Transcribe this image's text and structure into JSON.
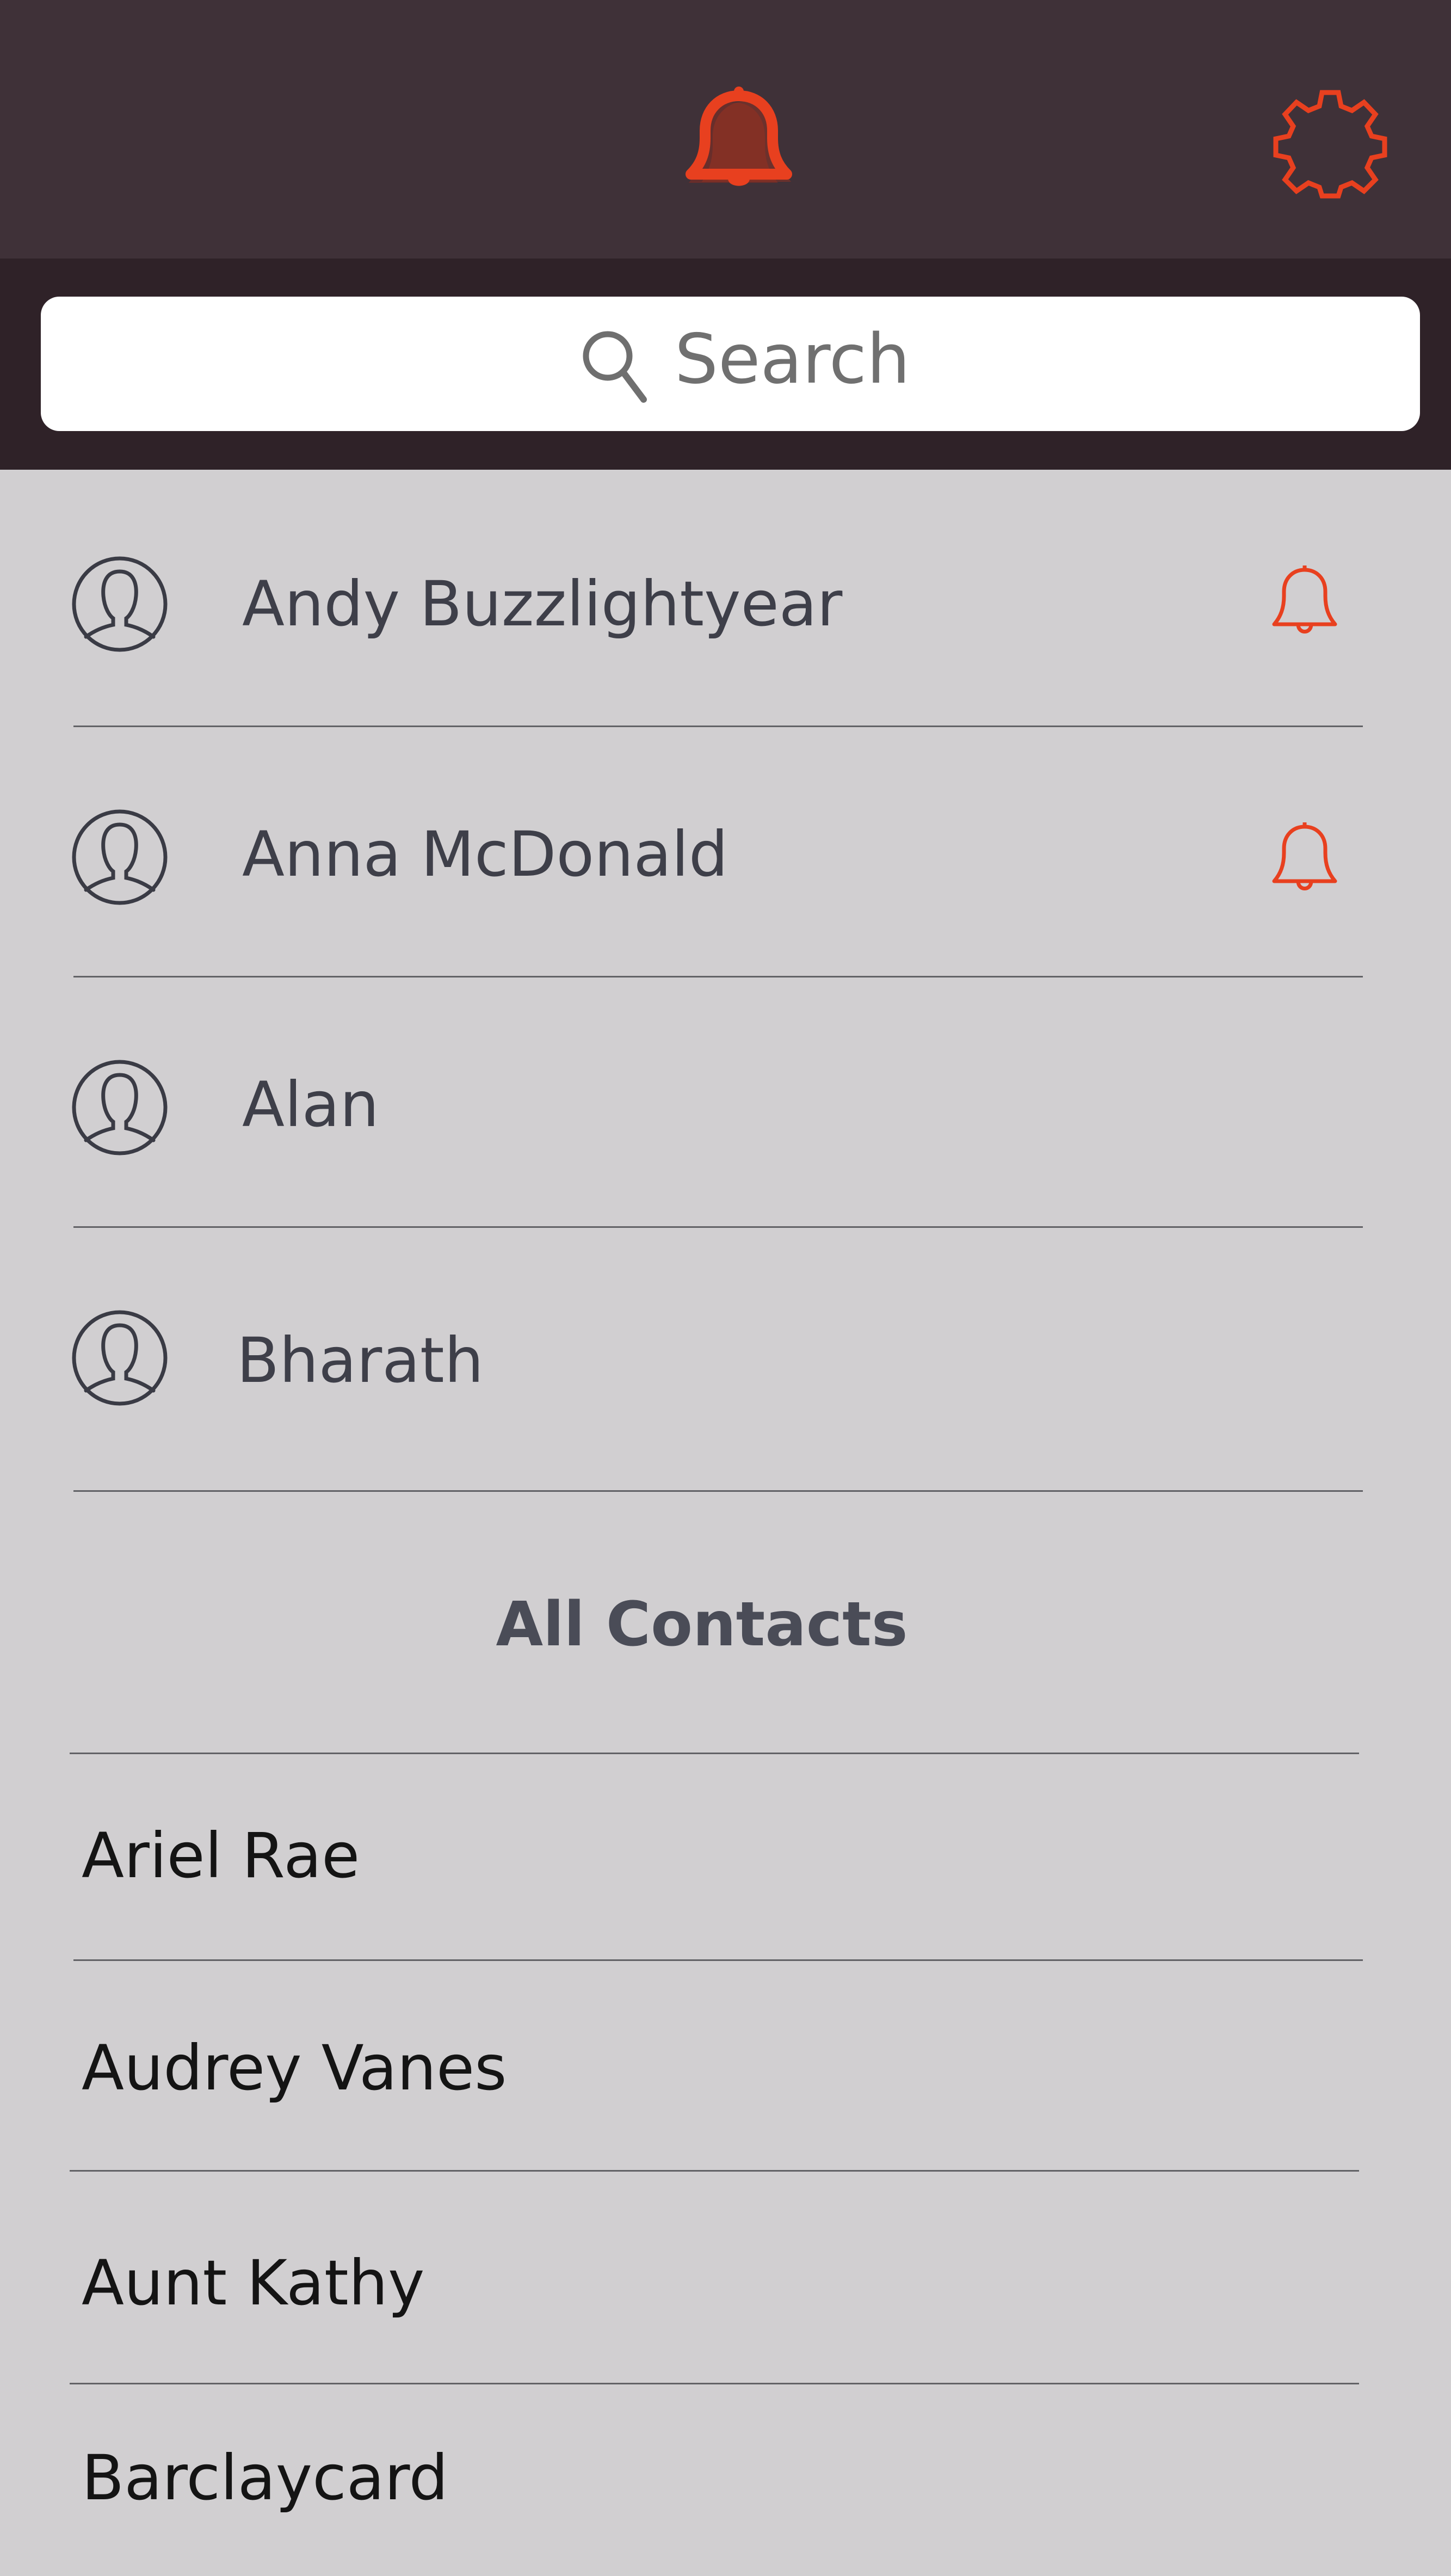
{
  "header": {
    "notifications_icon": "bell-icon",
    "settings_icon": "gear-icon",
    "accent_color": "#e8401f"
  },
  "search": {
    "placeholder": "Search",
    "icon": "search-icon"
  },
  "favorites": [
    {
      "name": "Andy Buzzlightyear",
      "notify": true
    },
    {
      "name": "Anna McDonald",
      "notify": true
    },
    {
      "name": "Alan",
      "notify": false
    },
    {
      "name": "Bharath",
      "notify": false
    }
  ],
  "all_contacts": {
    "title": "All Contacts",
    "items": [
      {
        "name": "Ariel Rae"
      },
      {
        "name": "Audrey Vanes"
      },
      {
        "name": "Aunt Kathy"
      },
      {
        "name": "Barclaycard"
      }
    ]
  }
}
